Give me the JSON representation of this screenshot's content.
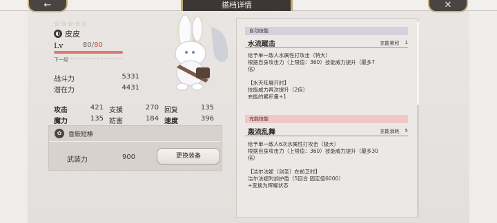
{
  "window": {
    "title": "搭档详情"
  },
  "nav": {
    "back_icon": "←",
    "close_icon": "✕"
  },
  "character": {
    "stars": "☆☆☆☆☆",
    "element_icon": "◐",
    "name": "皮皮",
    "level_label": "Lv",
    "level": "80/",
    "level_max": "80",
    "xp_progress": 1.0,
    "next_level_label": "下一级"
  },
  "power": {
    "combat_label": "战斗力",
    "combat_value": "5331",
    "potential_label": "潜在力",
    "potential_value": "4431"
  },
  "stats": [
    [
      {
        "label": "攻击",
        "value": "421",
        "bold": true
      },
      {
        "label": "支援",
        "value": "270",
        "bold": false
      },
      {
        "label": "回复",
        "value": "135",
        "bold": false
      }
    ],
    [
      {
        "label": "魔力",
        "value": "135",
        "bold": true
      },
      {
        "label": "妨害",
        "value": "184",
        "bold": false
      },
      {
        "label": "速度",
        "value": "396",
        "bold": true
      }
    ]
  ],
  "equipment": {
    "icon": "✿",
    "name": "昏厥短棒",
    "armament_label": "武装力",
    "armament_value": "900",
    "change_button": "更换装备"
  },
  "skills": {
    "auto": {
      "section_label": "自动技能",
      "name": "水流蹴击",
      "meta_label": "充能累积",
      "meta_value": "1",
      "desc_lines": [
        "给予单一敌人水属性打攻击（特大）",
        "根据自身攻击力（上限值：360）技能威力提升（最多7",
        "倍）",
        "",
        "【水天阵展开时】",
        "技能威力再次提升（2倍）",
        "充能的累积量+1"
      ]
    },
    "charge": {
      "section_label": "充能技能",
      "name": "轰流乱舞",
      "meta_label": "充能消耗",
      "meta_value": "5",
      "desc_lines": [
        "给予单一敌人6次水属性打攻击（极大）",
        "根据自身攻击力（上限值：360）技能威力提升（最多30",
        "倍）",
        "",
        "【洁尔法妮（剑圣）在前卫时】",
        "洁尔法妮附加护盾（5回合  固定值6000）",
        "+变换为辉耀状态"
      ]
    }
  },
  "colors": {
    "accent_gold": "#c6a86b",
    "plate_dark": "#3c3636",
    "auto_header": "#d4d0dc",
    "charge_header": "#f0c7c6"
  }
}
